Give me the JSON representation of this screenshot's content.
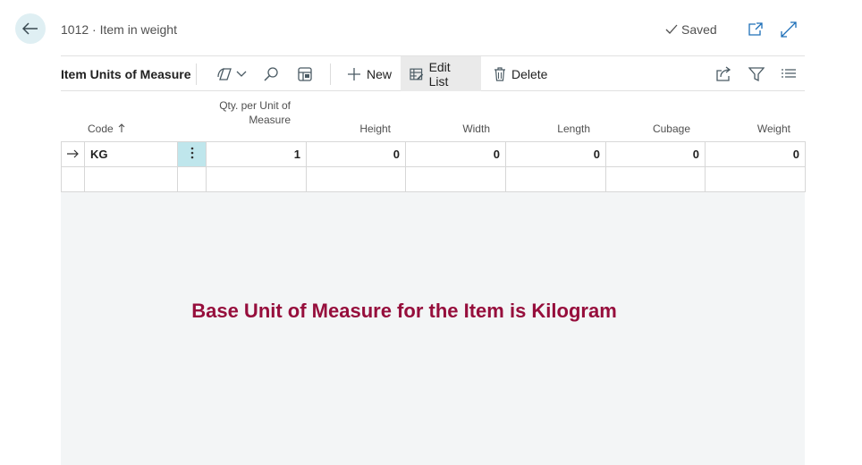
{
  "header": {
    "caption": "1012 · Item in weight",
    "saved_label": "Saved"
  },
  "toolbar": {
    "title": "Item Units of Measure",
    "new_label": "New",
    "edit_list_label": "Edit List",
    "delete_label": "Delete"
  },
  "columns": {
    "code": "Code",
    "qty_line1": "Qty. per Unit of",
    "qty_line2": "Measure",
    "height": "Height",
    "width": "Width",
    "length": "Length",
    "cubage": "Cubage",
    "weight": "Weight"
  },
  "rows": [
    {
      "code": "KG",
      "qty": "1",
      "height": "0",
      "width": "0",
      "length": "0",
      "cubage": "0",
      "weight": "0"
    }
  ],
  "overlay_text": "Base Unit of Measure for the Item is Kilogram",
  "colors": {
    "accent": "#960e3c",
    "selected_cell": "#bfe6ec",
    "back_button": "#dfeff3"
  }
}
